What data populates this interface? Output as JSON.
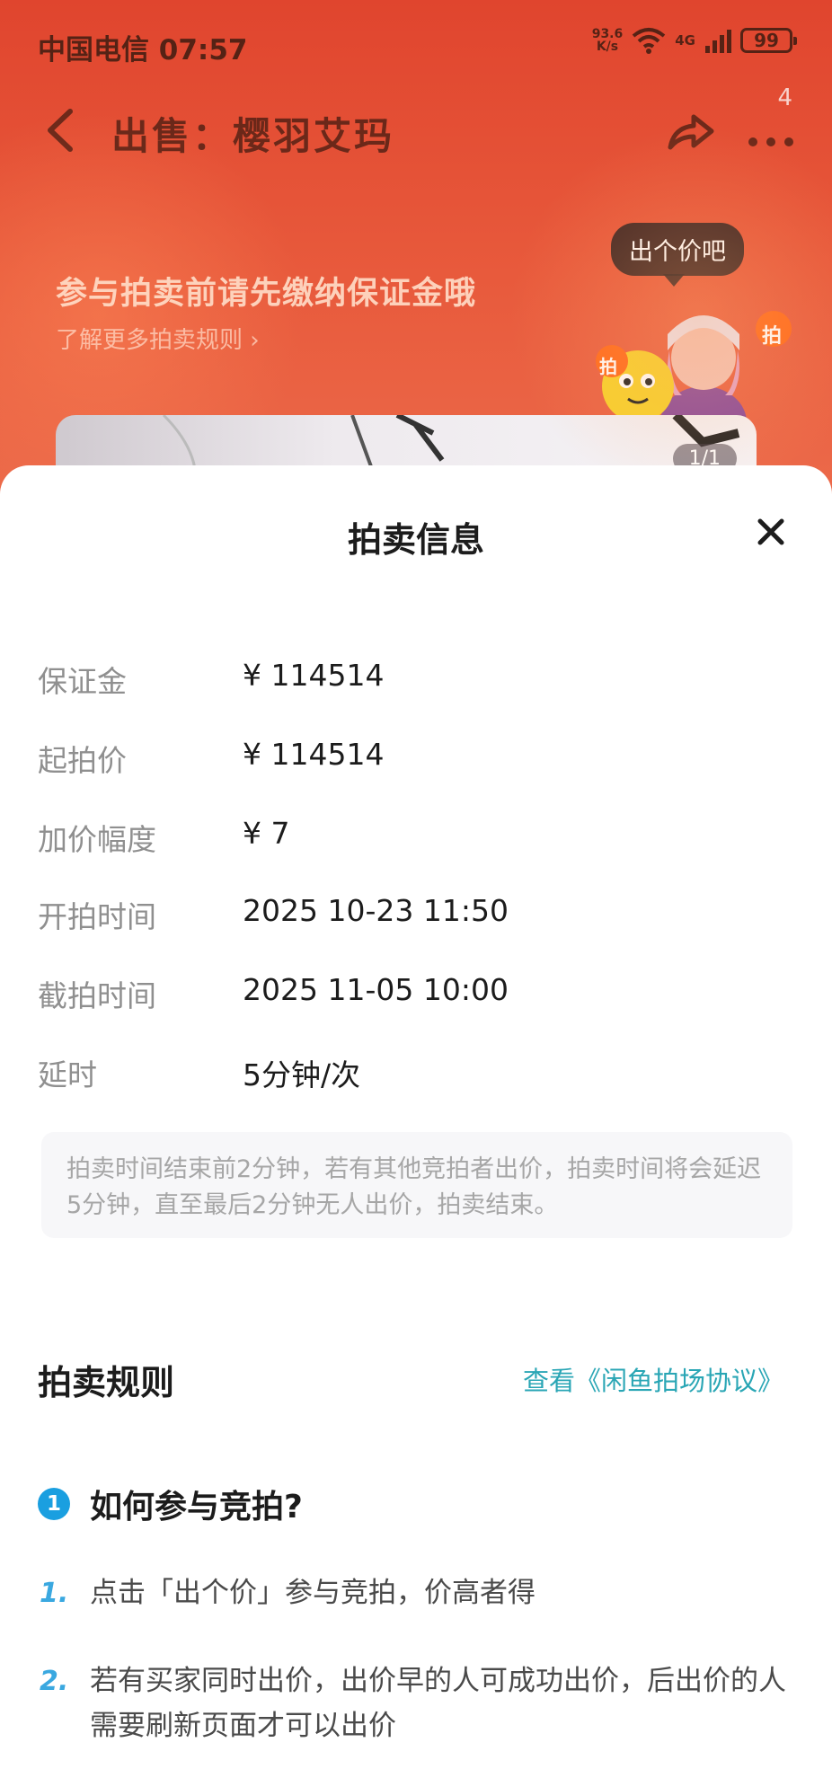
{
  "status_bar": {
    "carrier": "中国电信",
    "time": "07:57",
    "net_speed_value": "93.6",
    "net_speed_unit": "K/s",
    "network": "4G",
    "battery": "99"
  },
  "nav": {
    "title": "出售：樱羽艾玛",
    "more_badge": "4"
  },
  "hero": {
    "bubble": "出个价吧",
    "notice_title": "参与拍卖前请先缴纳保证金哦",
    "notice_link": "了解更多拍卖规则 ›",
    "mascot_text": "拍",
    "preview_counter": "1/1"
  },
  "sheet": {
    "title": "拍卖信息",
    "rows": [
      {
        "label": "保证金",
        "value": "¥ 114514"
      },
      {
        "label": "起拍价",
        "value": "¥ 114514"
      },
      {
        "label": "加价幅度",
        "value": "¥ 7"
      },
      {
        "label": "开拍时间",
        "value": "2025 10-23 11:50"
      },
      {
        "label": "截拍时间",
        "value": "2025 11-05 10:00"
      },
      {
        "label": "延时",
        "value": "5分钟/次"
      }
    ],
    "extend_note": "拍卖时间结束前2分钟，若有其他竞拍者出价，拍卖时间将会延迟5分钟，直至最后2分钟无人出价，拍卖结束。",
    "rules_title": "拍卖规则",
    "rules_link": "查看《闲鱼拍场协议》",
    "faq": {
      "number": "1",
      "title": "如何参与竞拍?",
      "steps": [
        {
          "num": "1.",
          "text": "点击「出个价」参与竞拍，价高者得"
        },
        {
          "num": "2.",
          "text": "若有买家同时出价，出价早的人可成功出价，后出价的人需要刷新页面才可以出价"
        }
      ]
    }
  },
  "colors": {
    "header_red": "#e0452e",
    "link_teal": "#2aa6b5",
    "faq_blue": "#1a9fe0"
  }
}
